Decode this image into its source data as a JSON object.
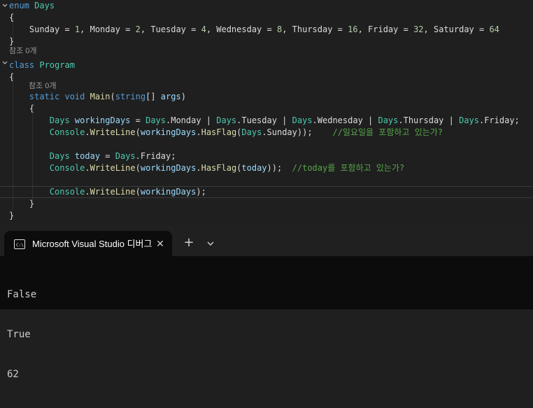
{
  "colors": {
    "keyword": "#569cd6",
    "type": "#4ec9b0",
    "enum_member": "#dcdcdc",
    "method": "#dcdcaa",
    "variable": "#9cdcfe",
    "number": "#b5cea8",
    "comment": "#57a64a",
    "plain": "#dcdcdc",
    "refs": "#9a9a9a",
    "terminal_text": "#cccccc"
  },
  "editor": {
    "lines": [
      [
        {
          "t": "enum ",
          "c": "keyword"
        },
        {
          "t": "Days",
          "c": "type"
        }
      ],
      [
        {
          "t": "{",
          "c": "plain"
        }
      ],
      [
        {
          "t": "    Sunday = ",
          "c": "plain"
        },
        {
          "t": "1",
          "c": "number"
        },
        {
          "t": ", Monday = ",
          "c": "plain"
        },
        {
          "t": "2",
          "c": "number"
        },
        {
          "t": ", Tuesday = ",
          "c": "plain"
        },
        {
          "t": "4",
          "c": "number"
        },
        {
          "t": ", Wednesday = ",
          "c": "plain"
        },
        {
          "t": "8",
          "c": "number"
        },
        {
          "t": ", Thursday = ",
          "c": "plain"
        },
        {
          "t": "16",
          "c": "number"
        },
        {
          "t": ", Friday = ",
          "c": "plain"
        },
        {
          "t": "32",
          "c": "number"
        },
        {
          "t": ", Saturday = ",
          "c": "plain"
        },
        {
          "t": "64",
          "c": "number"
        }
      ],
      [
        {
          "t": "}",
          "c": "plain"
        }
      ],
      [],
      [
        {
          "t": "class ",
          "c": "keyword"
        },
        {
          "t": "Program",
          "c": "type"
        }
      ],
      [
        {
          "t": "{",
          "c": "plain"
        }
      ],
      [],
      [
        {
          "t": "    static void ",
          "c": "keyword"
        },
        {
          "t": "Main",
          "c": "method"
        },
        {
          "t": "(",
          "c": "plain"
        },
        {
          "t": "string",
          "c": "keyword"
        },
        {
          "t": "[] ",
          "c": "plain"
        },
        {
          "t": "args",
          "c": "variable"
        },
        {
          "t": ")",
          "c": "plain"
        }
      ],
      [
        {
          "t": "    {",
          "c": "plain"
        }
      ],
      [
        {
          "t": "        ",
          "c": "plain"
        },
        {
          "t": "Days",
          "c": "type"
        },
        {
          "t": " workingDays",
          "c": "variable"
        },
        {
          "t": " = ",
          "c": "plain"
        },
        {
          "t": "Days",
          "c": "type"
        },
        {
          "t": ".Monday | ",
          "c": "plain"
        },
        {
          "t": "Days",
          "c": "type"
        },
        {
          "t": ".Tuesday | ",
          "c": "plain"
        },
        {
          "t": "Days",
          "c": "type"
        },
        {
          "t": ".Wednesday | ",
          "c": "plain"
        },
        {
          "t": "Days",
          "c": "type"
        },
        {
          "t": ".Thursday | ",
          "c": "plain"
        },
        {
          "t": "Days",
          "c": "type"
        },
        {
          "t": ".Friday;",
          "c": "plain"
        }
      ],
      [
        {
          "t": "        ",
          "c": "plain"
        },
        {
          "t": "Console",
          "c": "type"
        },
        {
          "t": ".",
          "c": "plain"
        },
        {
          "t": "WriteLine",
          "c": "method"
        },
        {
          "t": "(",
          "c": "plain"
        },
        {
          "t": "workingDays",
          "c": "variable"
        },
        {
          "t": ".",
          "c": "plain"
        },
        {
          "t": "HasFlag",
          "c": "method"
        },
        {
          "t": "(",
          "c": "plain"
        },
        {
          "t": "Days",
          "c": "type"
        },
        {
          "t": ".Sunday));    ",
          "c": "plain"
        },
        {
          "t": "//일요일을 포함하고 있는가?",
          "c": "comment"
        }
      ],
      [],
      [
        {
          "t": "        ",
          "c": "plain"
        },
        {
          "t": "Days",
          "c": "type"
        },
        {
          "t": " today",
          "c": "variable"
        },
        {
          "t": " = ",
          "c": "plain"
        },
        {
          "t": "Days",
          "c": "type"
        },
        {
          "t": ".Friday;",
          "c": "plain"
        }
      ],
      [
        {
          "t": "        ",
          "c": "plain"
        },
        {
          "t": "Console",
          "c": "type"
        },
        {
          "t": ".",
          "c": "plain"
        },
        {
          "t": "WriteLine",
          "c": "method"
        },
        {
          "t": "(",
          "c": "plain"
        },
        {
          "t": "workingDays",
          "c": "variable"
        },
        {
          "t": ".",
          "c": "plain"
        },
        {
          "t": "HasFlag",
          "c": "method"
        },
        {
          "t": "(",
          "c": "plain"
        },
        {
          "t": "today",
          "c": "variable"
        },
        {
          "t": "));  ",
          "c": "plain"
        },
        {
          "t": "//today를 포함하고 있는가?",
          "c": "comment"
        }
      ],
      [],
      [
        {
          "t": "        ",
          "c": "plain"
        },
        {
          "t": "Console",
          "c": "type"
        },
        {
          "t": ".",
          "c": "plain"
        },
        {
          "t": "WriteLine",
          "c": "method"
        },
        {
          "t": "(",
          "c": "plain"
        },
        {
          "t": "workingDays",
          "c": "variable"
        },
        {
          "t": ");",
          "c": "plain"
        }
      ],
      [
        {
          "t": "    }",
          "c": "plain"
        }
      ],
      [
        {
          "t": "}",
          "c": "plain"
        }
      ]
    ],
    "refs_class": "참조 0개",
    "refs_main": "참조 0개"
  },
  "terminal": {
    "tab_title": "Microsoft Visual Studio 디버그",
    "tab_icon": "terminal-icon",
    "close_icon": "close-icon",
    "new_tab_label": "+",
    "dropdown_icon": "chevron-down-icon",
    "output_lines": [
      "False",
      "True",
      "62"
    ]
  }
}
